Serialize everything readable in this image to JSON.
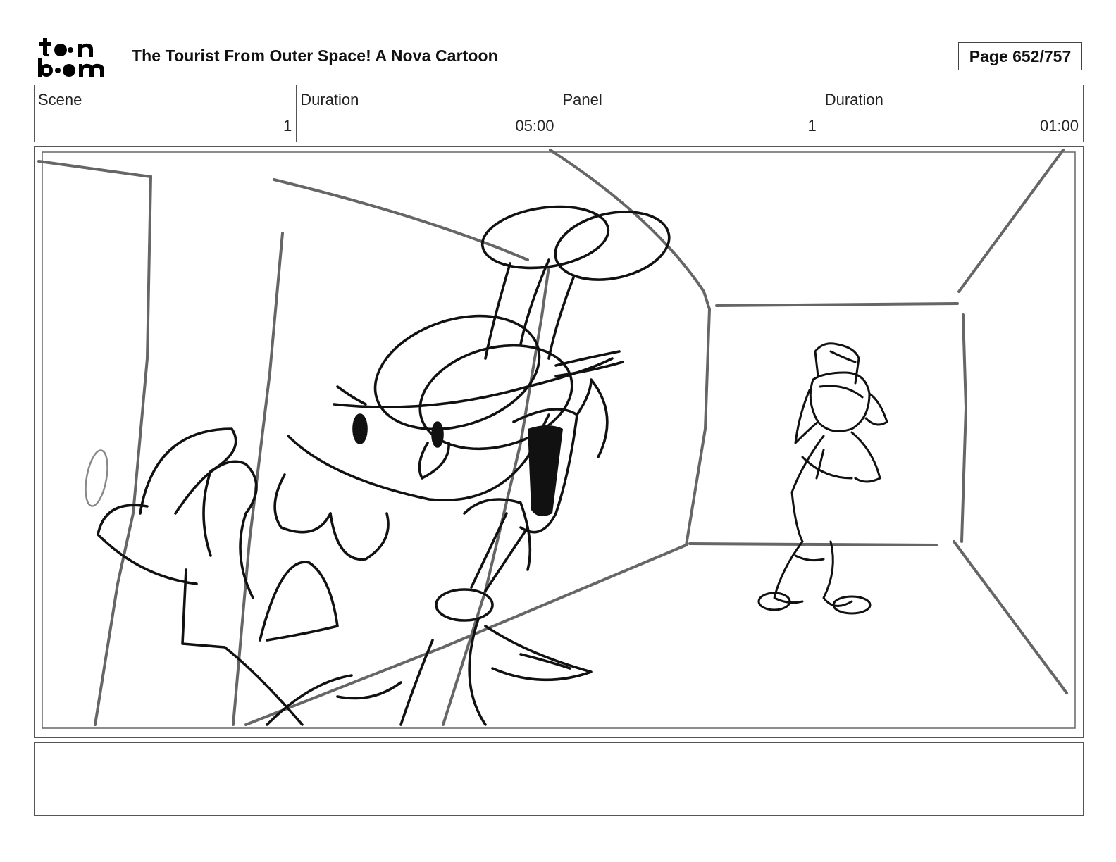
{
  "header": {
    "logo_text": "toon boom",
    "title": "The Tourist From Outer Space!  A Nova Cartoon",
    "page_label": "Page 652/757"
  },
  "info": [
    {
      "label": "Scene",
      "value": "1"
    },
    {
      "label": "Duration",
      "value": "05:00"
    },
    {
      "label": "Panel",
      "value": "1"
    },
    {
      "label": "Duration",
      "value": "01:00"
    }
  ],
  "notes": {
    "text": ""
  },
  "colors": {
    "line": "#111111",
    "guide": "#666666",
    "frame": "#555555"
  }
}
